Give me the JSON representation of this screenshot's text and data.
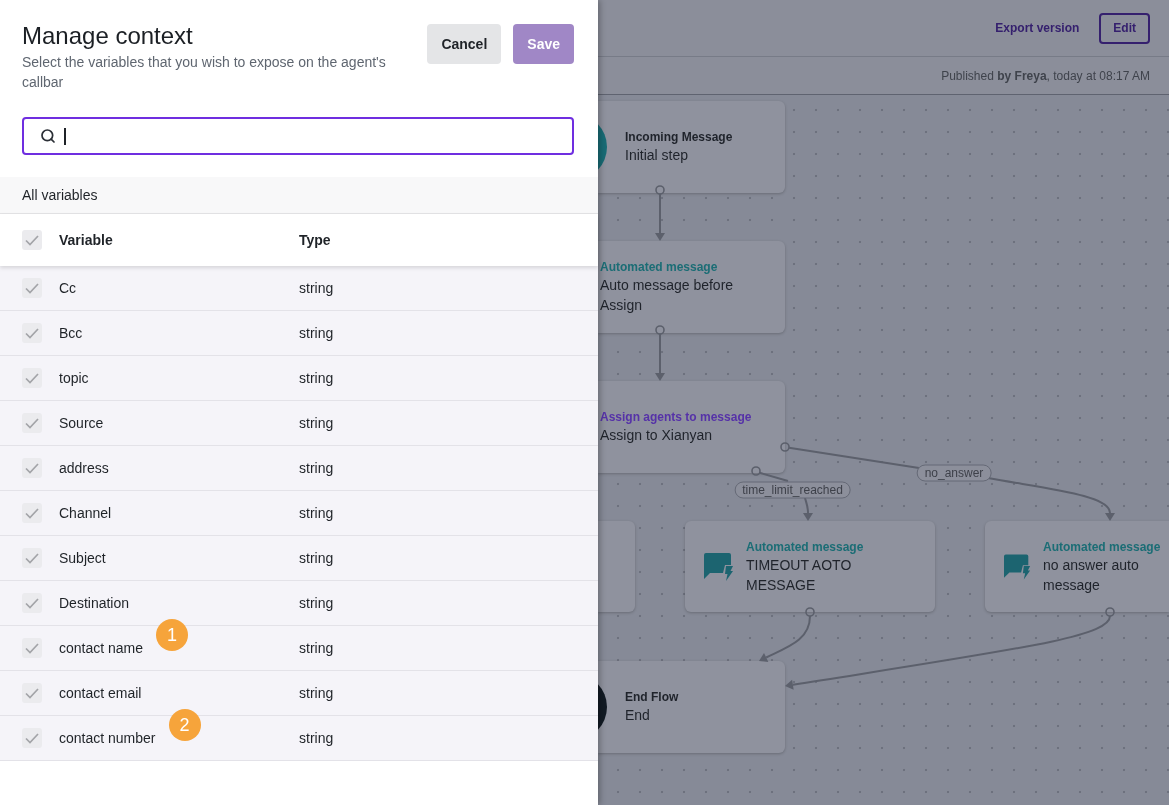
{
  "dialog": {
    "title": "Manage context",
    "subtitle": "Select the variables that you wish to expose on the agent's callbar",
    "buttons": [
      {
        "label": "Cancel",
        "kind": "secondary",
        "disabled": false
      },
      {
        "label": "Save",
        "kind": "primary",
        "disabled": true
      }
    ],
    "search": {
      "focused": true
    },
    "section": "All variables",
    "table": {
      "header_checked": true,
      "columns": [
        "Variable",
        "Type"
      ],
      "rows": [
        {
          "name": "Cc",
          "type": "string",
          "checked": true
        },
        {
          "name": "Bcc",
          "type": "string",
          "checked": true
        },
        {
          "name": "topic",
          "type": "string",
          "checked": true
        },
        {
          "name": "Source",
          "type": "string",
          "checked": true
        },
        {
          "name": "address",
          "type": "string",
          "checked": true
        },
        {
          "name": "Channel",
          "type": "string",
          "checked": true
        },
        {
          "name": "Subject",
          "type": "string",
          "checked": true
        },
        {
          "name": "Destination",
          "type": "string",
          "checked": true
        },
        {
          "name": "contact name",
          "type": "string",
          "checked": true,
          "marker": "1"
        },
        {
          "name": "contact email",
          "type": "string",
          "checked": true
        },
        {
          "name": "contact number",
          "type": "string",
          "checked": true,
          "marker": "2"
        }
      ]
    }
  },
  "flow_editor": {
    "actions": [
      {
        "label": "Export version",
        "kind": "link"
      },
      {
        "label": "Edit",
        "kind": "outlined"
      }
    ],
    "published": "Published **by Freya**, today at 08:17 AM",
    "nodes": [
      {
        "kind": "start",
        "category": "Incoming Message",
        "title": "Initial step"
      },
      {
        "kind": "message",
        "category": "Automated message",
        "title": "Auto message before Assign"
      },
      {
        "kind": "assign",
        "category": "Assign agents to message",
        "title": "Assign to Xianyan"
      },
      {
        "kind": "covered"
      },
      {
        "kind": "message",
        "category": "Automated message",
        "title": "TIMEOUT AOTO MESSAGE"
      },
      {
        "kind": "message",
        "category": "Automated message",
        "title": "no answer auto message"
      },
      {
        "kind": "end",
        "category": "End Flow",
        "title": "End"
      }
    ],
    "edge_labels": [
      "time_limit_reached",
      "no_answer"
    ]
  }
}
